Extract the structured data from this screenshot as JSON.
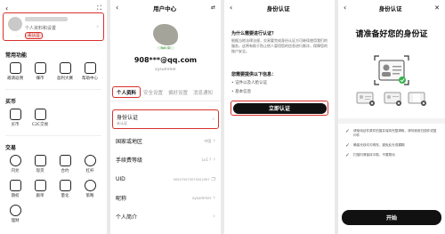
{
  "p1": {
    "avatar_name": "████████",
    "profile_sub": "个人资料和设置",
    "badge": "未认证",
    "sections": [
      {
        "title": "常用功能",
        "items": [
          "邀请返佣",
          "赚币",
          "盈利大赛",
          "帮助中心"
        ]
      },
      {
        "title": "买币",
        "items": [
          "买币",
          "C2C交易"
        ]
      },
      {
        "title": "交易",
        "items": [
          "闪兑",
          "现货",
          "合约",
          "杠杆",
          "期权",
          "跟单",
          "量化",
          "策略",
          "理财"
        ]
      }
    ]
  },
  "p2": {
    "title": "用户中心",
    "avatar_tag": "Not ID",
    "email": "908***@qq.com",
    "nickname": "xysummer",
    "tabs": [
      "个人资料",
      "安全设置",
      "偏好设置",
      "消息通知"
    ],
    "id_row": {
      "label": "身份认证",
      "sub": "未认证"
    },
    "rows": [
      {
        "label": "国家或地区",
        "value": "中国"
      },
      {
        "label": "手续费等级",
        "value": "Lv1 ?"
      },
      {
        "label": "UID",
        "value": "305375973575922497"
      },
      {
        "label": "昵称",
        "value": "xysummer"
      },
      {
        "label": "个人简介",
        "value": ""
      }
    ]
  },
  "p3": {
    "title": "身份认证",
    "q1": "为什么需要进行认证？",
    "a1": "根据当地法律法规，交易要完成身份认证方可继续使用我们的服务，这将有助于防止他人冒用您的信息进行欺诈，保障您的账户安全。",
    "q2": "您需要提供以下信息：",
    "items": [
      "证件以及人脸认证",
      "基本信息"
    ],
    "button": "立即认证"
  },
  "p4": {
    "title": "身份认证",
    "heading": "请准备好您的身份证",
    "bullets": [
      "请使用证件原件拍摄并保持完整清晰，请勿使用扫描件或复印件",
      "确保光线均匀明亮，避免反光或模糊",
      "扫描时请保持平稳，不要晃动"
    ],
    "button": "开始"
  }
}
